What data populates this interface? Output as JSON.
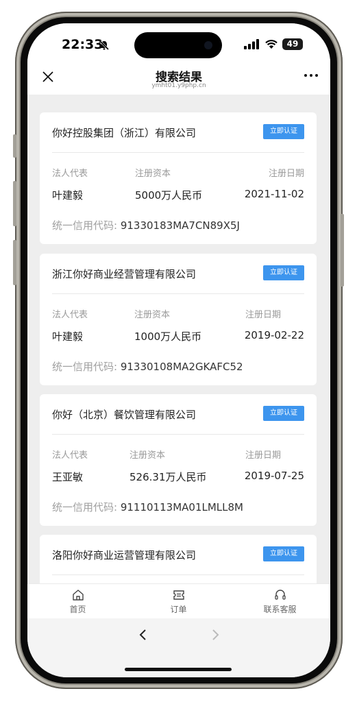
{
  "status_bar": {
    "time": "22:33",
    "battery": "49"
  },
  "nav": {
    "title": "搜索结果",
    "url": "ymht01.y9php.cn"
  },
  "field_labels": {
    "legal_rep": "法人代表",
    "capital": "注册资本",
    "date": "注册日期",
    "credit_code": "统一信用代码:"
  },
  "verify_label": "立即认证",
  "companies": [
    {
      "name": "你好控股集团（浙江）有限公司",
      "legal_rep": "叶建毅",
      "capital": "5000万人民币",
      "date": "2021-11-02",
      "credit_code": "91330183MA7CN89X5J"
    },
    {
      "name": "浙江你好商业经营管理有限公司",
      "legal_rep": "叶建毅",
      "capital": "1000万人民币",
      "date": "2019-02-22",
      "credit_code": "91330108MA2GKAFC52"
    },
    {
      "name": "你好（北京）餐饮管理有限公司",
      "legal_rep": "王亚敏",
      "capital": "526.31万人民币",
      "date": "2019-07-25",
      "credit_code": "91110113MA01LMLL8M"
    },
    {
      "name": "洛阳你好商业运营管理有限公司"
    }
  ],
  "tabs": [
    {
      "label": "首页",
      "icon": "home-icon"
    },
    {
      "label": "订单",
      "icon": "ticket-icon"
    },
    {
      "label": "联系客服",
      "icon": "headset-icon"
    }
  ],
  "colors": {
    "accent": "#3d95ee",
    "background": "#eeeeee"
  }
}
